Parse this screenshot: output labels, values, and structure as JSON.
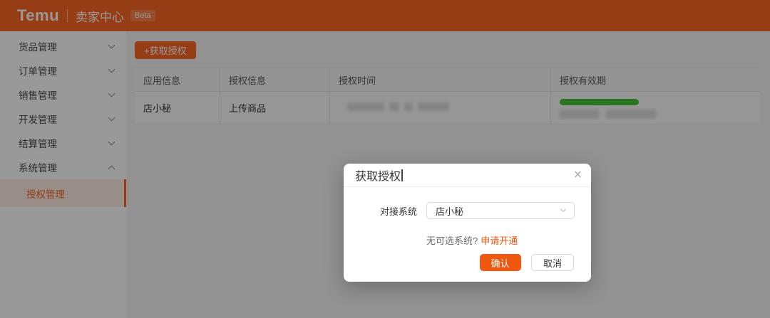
{
  "header": {
    "logo": "Temu",
    "title": "卖家中心",
    "badge": "Beta"
  },
  "sidebar": {
    "items": [
      {
        "label": "货品管理"
      },
      {
        "label": "订单管理"
      },
      {
        "label": "销售管理"
      },
      {
        "label": "开发管理"
      },
      {
        "label": "结算管理"
      },
      {
        "label": "系统管理"
      }
    ],
    "active_subitem": {
      "label": "授权管理"
    }
  },
  "main": {
    "add_button_label": "+获取授权",
    "table": {
      "columns": [
        {
          "label": "应用信息"
        },
        {
          "label": "授权信息"
        },
        {
          "label": "授权时间"
        },
        {
          "label": "授权有效期"
        }
      ],
      "rows": [
        {
          "app_name": "店小秘",
          "auth_info": "上传商品",
          "auth_time_redacted": true,
          "validity_redacted": true,
          "validity_progress": "full"
        }
      ]
    }
  },
  "modal": {
    "title": "获取授权",
    "close_glyph": "×",
    "field_label": "对接系统",
    "select_value": "店小秘",
    "hint_text": "无可选系统?",
    "hint_link": "申请开通",
    "confirm_label": "确认",
    "cancel_label": "取消"
  },
  "colors": {
    "brand_orange": "#FA6723",
    "accent": "#F0570F",
    "progress_green": "#45C437",
    "active_item_bg": "#FFECE3",
    "overlay": "rgba(0,0,0,0.40)"
  }
}
